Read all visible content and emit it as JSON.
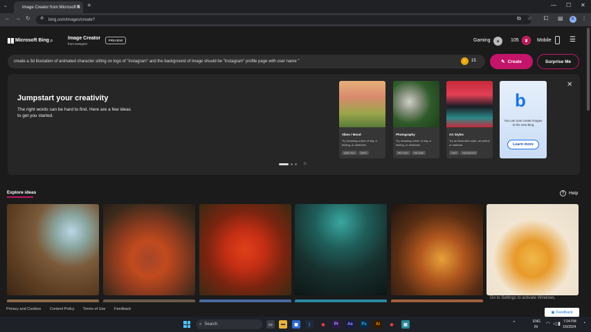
{
  "browser": {
    "tab_title": "Image Creator from Microsoft B",
    "url": "bing.com/images/create?",
    "profile_initial": "K"
  },
  "header": {
    "brand": "Microsoft Bing",
    "product_title": "Image Creator",
    "product_sub": "from Designer",
    "preview_badge": "PREVIEW",
    "gaming_label": "Gaming",
    "points": "105",
    "mobile_label": "Mobile"
  },
  "prompt": {
    "text": "create a 3d illustation of animated character sitting on logo of \"instagram\" and the background of image should be \"instagram\" profile page with user name \"",
    "boost_count": "15",
    "create_label": "Create",
    "surprise_label": "Surprise Me"
  },
  "jumpstart": {
    "title": "Jumpstart your creativity",
    "text": "The right words can be hard to find. Here are a few ideas to get you started.",
    "cards": [
      {
        "title": "Vibes / Mood",
        "desc": "Try including a time of day, a feeling, or aesthetic.",
        "tags": [
          "golden hour",
          "playful"
        ]
      },
      {
        "title": "Photography",
        "desc": "Try including a time of day, a feeling, or aesthetic.",
        "tags": [
          "35mm lens",
          "wide angle"
        ]
      },
      {
        "title": "Art Styles",
        "desc": "Try an illustration style, art period or material.",
        "tags": [
          "matrix",
          "impressionism"
        ]
      }
    ],
    "bing_card_text": "You can now create images in the new Bing",
    "learn_more": "Learn more"
  },
  "explore": {
    "title": "Explore ideas",
    "help": "Help"
  },
  "watermark": "Go to Settings to activate Windows.",
  "footer": {
    "links": [
      "Privacy and Cookies",
      "Content Policy",
      "Terms of Use",
      "Feedback"
    ],
    "feedback_button": "Feedback"
  },
  "taskbar": {
    "search_label": "Search",
    "lang1": "ENG",
    "lang2": "IN",
    "time": "7:24 PM",
    "date": "1/9/2024"
  },
  "colors": {
    "accent": "#c4156a",
    "background": "#1b1b1b"
  }
}
